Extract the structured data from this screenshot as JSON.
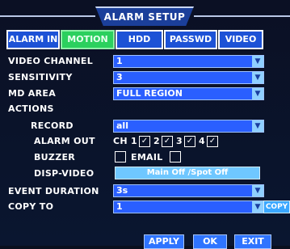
{
  "title": "ALARM SETUP",
  "tabs": [
    "ALARM IN",
    "MOTION",
    "HDD",
    "PASSWD",
    "VIDEO"
  ],
  "active_tab": "MOTION",
  "fields": {
    "video_channel": {
      "label": "VIDEO CHANNEL",
      "value": "1"
    },
    "sensitivity": {
      "label": "SENSITIVITY",
      "value": "3"
    },
    "md_area": {
      "label": "MD AREA",
      "value": "FULL REGION"
    },
    "actions_label": "ACTIONS",
    "record": {
      "label": "RECORD",
      "value": "all"
    },
    "alarm_out": {
      "label": "ALARM OUT",
      "prefix": "CH",
      "channels": [
        "1",
        "2",
        "3",
        "4"
      ],
      "checked": [
        true,
        true,
        true,
        true
      ]
    },
    "buzzer": {
      "label": "BUZZER",
      "checked": false,
      "email_label": "EMAIL",
      "email_checked": false
    },
    "disp_video": {
      "label": "DISP-VIDEO",
      "value": "Main Off /Spot Off"
    },
    "event_duration": {
      "label": "EVENT DURATION",
      "value": "3s"
    },
    "copy_to": {
      "label": "COPY TO",
      "value": "1",
      "copy_button": "COPY"
    }
  },
  "buttons": {
    "apply": "APPLY",
    "ok": "OK",
    "exit": "EXIT"
  },
  "check_glyph": "✓",
  "dropdown_glyph": "▼",
  "colors": {
    "tab_active": "#2bd05e",
    "tab": "#1d52d6",
    "field": "#2a5fff",
    "dropdown": "#8fd0ff",
    "background": "#0a0f1e"
  }
}
